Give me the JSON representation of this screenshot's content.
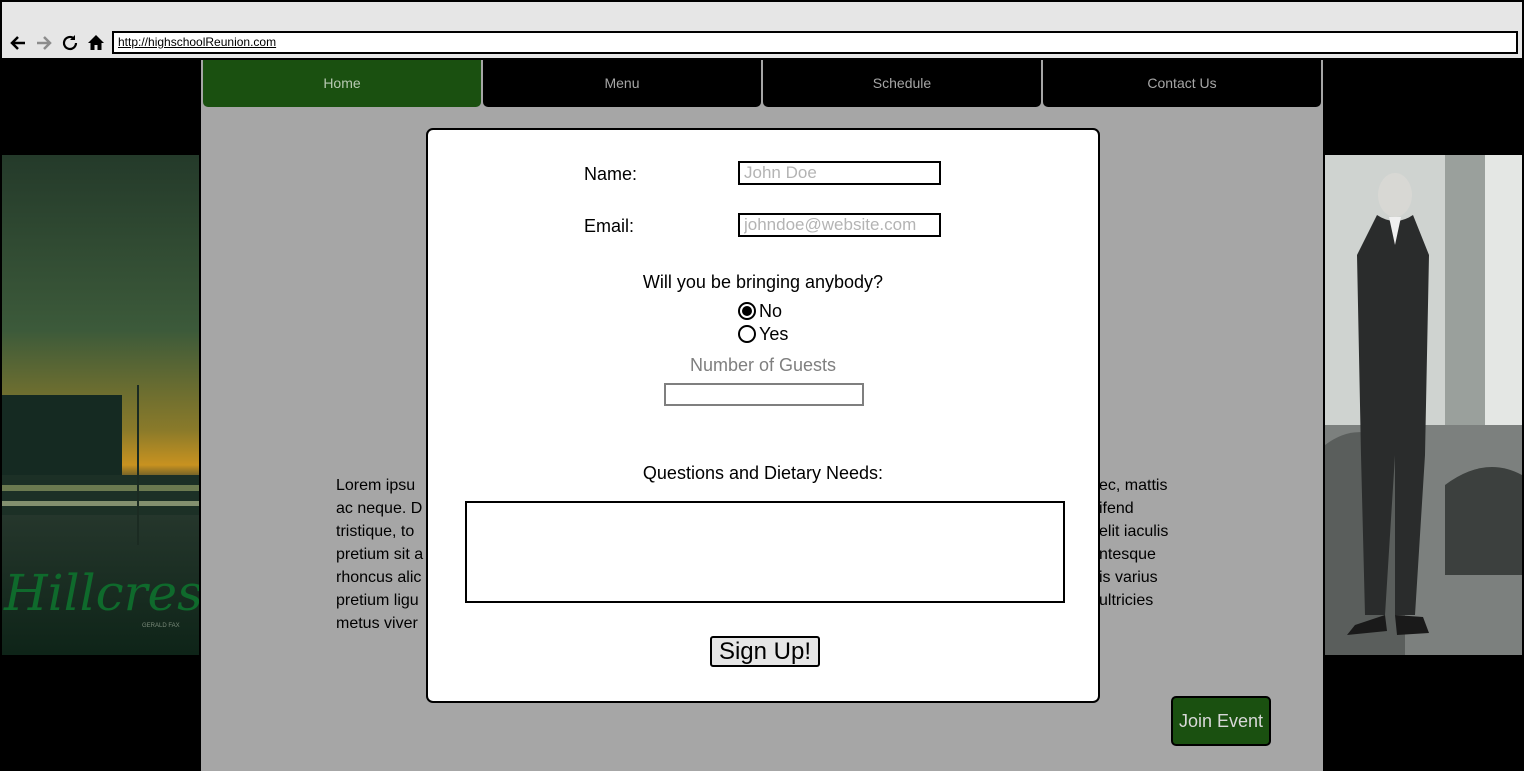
{
  "browser": {
    "url": "http://highschoolReunion.com",
    "icons": [
      "back-arrow-icon",
      "forward-arrow-icon",
      "reload-icon",
      "home-icon"
    ]
  },
  "nav": {
    "tabs": [
      {
        "label": "Home",
        "active": true
      },
      {
        "label": "Menu",
        "active": false
      },
      {
        "label": "Schedule",
        "active": false
      },
      {
        "label": "Contact Us",
        "active": false
      }
    ]
  },
  "side_photos": {
    "left_text": "Hillcrest",
    "left_caption": "GERALD FAX"
  },
  "body_text": {
    "left_fragments": [
      "Lorem ipsu",
      "ac neque. D",
      "tristique, to",
      "pretium sit a",
      "rhoncus alic",
      "pretium ligu",
      "metus viver"
    ],
    "right_fragments": [
      "ec, mattis",
      "ifend",
      "elit iaculis",
      "ntesque",
      "is varius",
      "ultricies",
      ""
    ]
  },
  "join_button": "Join Event",
  "modal": {
    "name_label": "Name:",
    "name_placeholder": "John Doe",
    "email_label": "Email:",
    "email_placeholder": "johndoe@website.com",
    "bringing_question": "Will you be bringing anybody?",
    "option_no": "No",
    "option_yes": "Yes",
    "selected_option": "No",
    "guests_label": "Number of Guests",
    "notes_label": "Questions and Dietary Needs:",
    "submit_label": "Sign Up!"
  },
  "colors": {
    "accent_green": "#1a5010",
    "page_background": "#a6a6a6",
    "chrome": "#e6e6e6"
  }
}
